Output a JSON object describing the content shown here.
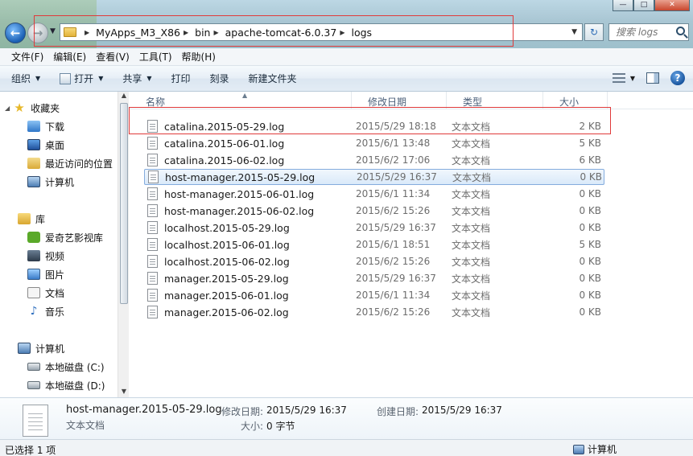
{
  "window": {
    "minimize": "—",
    "maximize": "□",
    "close": "✕"
  },
  "address": {
    "crumbs": [
      "MyApps_M3_X86",
      "bin",
      "apache-tomcat-6.0.37",
      "logs"
    ]
  },
  "search": {
    "placeholder": "搜索 logs"
  },
  "menu": [
    "文件(F)",
    "编辑(E)",
    "查看(V)",
    "工具(T)",
    "帮助(H)"
  ],
  "toolbar": {
    "organize": "组织",
    "open": "打开",
    "share": "共享",
    "print": "打印",
    "burn": "刻录",
    "new_folder": "新建文件夹"
  },
  "nav": {
    "favorites": "收藏夹",
    "downloads": "下载",
    "desktop": "桌面",
    "recent": "最近访问的位置",
    "computer_fav": "计算机",
    "library": "库",
    "iqiyi": "爱奇艺影视库",
    "video": "视频",
    "pictures": "图片",
    "documents": "文档",
    "music": "音乐",
    "computer": "计算机",
    "drive_c": "本地磁盘 (C:)",
    "drive_d": "本地磁盘 (D:)"
  },
  "columns": {
    "name": "名称",
    "date": "修改日期",
    "type": "类型",
    "size": "大小"
  },
  "files": [
    {
      "name": "catalina.2015-05-29.log",
      "date": "2015/5/29 18:18",
      "type": "文本文档",
      "size": "2 KB"
    },
    {
      "name": "catalina.2015-06-01.log",
      "date": "2015/6/1 13:48",
      "type": "文本文档",
      "size": "5 KB"
    },
    {
      "name": "catalina.2015-06-02.log",
      "date": "2015/6/2 17:06",
      "type": "文本文档",
      "size": "6 KB"
    },
    {
      "name": "host-manager.2015-05-29.log",
      "date": "2015/5/29 16:37",
      "type": "文本文档",
      "size": "0 KB"
    },
    {
      "name": "host-manager.2015-06-01.log",
      "date": "2015/6/1 11:34",
      "type": "文本文档",
      "size": "0 KB"
    },
    {
      "name": "host-manager.2015-06-02.log",
      "date": "2015/6/2 15:26",
      "type": "文本文档",
      "size": "0 KB"
    },
    {
      "name": "localhost.2015-05-29.log",
      "date": "2015/5/29 16:37",
      "type": "文本文档",
      "size": "0 KB"
    },
    {
      "name": "localhost.2015-06-01.log",
      "date": "2015/6/1 18:51",
      "type": "文本文档",
      "size": "5 KB"
    },
    {
      "name": "localhost.2015-06-02.log",
      "date": "2015/6/2 15:26",
      "type": "文本文档",
      "size": "0 KB"
    },
    {
      "name": "manager.2015-05-29.log",
      "date": "2015/5/29 16:37",
      "type": "文本文档",
      "size": "0 KB"
    },
    {
      "name": "manager.2015-06-01.log",
      "date": "2015/6/1 11:34",
      "type": "文本文档",
      "size": "0 KB"
    },
    {
      "name": "manager.2015-06-02.log",
      "date": "2015/6/2 15:26",
      "type": "文本文档",
      "size": "0 KB"
    }
  ],
  "selected_index": 3,
  "details": {
    "filename": "host-manager.2015-05-29.log",
    "filetype": "文本文档",
    "modified_label": "修改日期:",
    "modified": "2015/5/29 16:37",
    "created_label": "创建日期:",
    "created": "2015/5/29 16:37",
    "size_label": "大小:",
    "size": "0 字节"
  },
  "status": {
    "selection": "已选择 1 项",
    "location": "计算机"
  },
  "colors": {
    "highlight_box": "#e03a3a",
    "selection_border": "#84acdd"
  }
}
